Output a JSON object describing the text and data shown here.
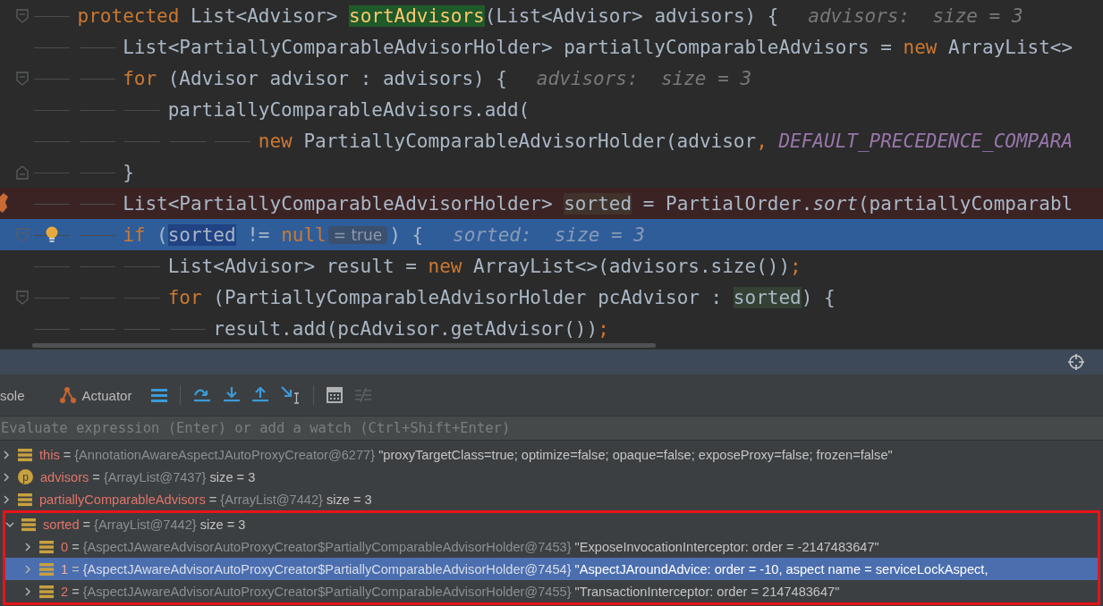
{
  "editor": {
    "lines": [
      {
        "fold_start": true,
        "fold_end": false,
        "breakpoint": false,
        "execution": false,
        "bulb": false,
        "continuation": false,
        "tokens": [
          {
            "kind": "keyword",
            "text": "protected"
          },
          {
            "kind": "text",
            "text": " List<Advisor> "
          },
          {
            "kind": "method",
            "text": "sortAdvisors"
          },
          {
            "kind": "text",
            "text": "(List<Advisor> advisors) {"
          },
          {
            "kind": "hint",
            "text": "advisors:  size = 3"
          }
        ],
        "children": [
          {
            "fold_start": false,
            "fold_end": false,
            "breakpoint": false,
            "execution": false,
            "bulb": false,
            "continuation": false,
            "tokens": [
              {
                "kind": "text",
                "text": "List<PartiallyComparableAdvisorHolder> partiallyComparableAdvisors = "
              },
              {
                "kind": "keyword",
                "text": "new"
              },
              {
                "kind": "text",
                "text": " ArrayList<>"
              }
            ]
          },
          {
            "fold_start": true,
            "fold_end": false,
            "breakpoint": false,
            "execution": false,
            "bulb": false,
            "continuation": false,
            "tokens": [
              {
                "kind": "keyword",
                "text": "for"
              },
              {
                "kind": "text",
                "text": " (Advisor advisor : advisors) {"
              },
              {
                "kind": "hint",
                "text": "advisors:  size = 3"
              }
            ],
            "children": [
              {
                "fold_start": false,
                "fold_end": false,
                "breakpoint": false,
                "execution": false,
                "bulb": false,
                "continuation": false,
                "tokens": [
                  {
                    "kind": "text",
                    "text": "partiallyComparableAdvisors.add("
                  }
                ],
                "children": [
                  {
                    "fold_start": false,
                    "fold_end": false,
                    "breakpoint": false,
                    "execution": false,
                    "bulb": false,
                    "continuation": true,
                    "tokens": [
                      {
                        "kind": "keyword",
                        "text": "new"
                      },
                      {
                        "kind": "text",
                        "text": " PartiallyComparableAdvisorHolder(advisor"
                      },
                      {
                        "kind": "keyword",
                        "text": ","
                      },
                      {
                        "kind": "constant",
                        "text": " DEFAULT_PRECEDENCE_COMPARA"
                      }
                    ]
                  }
                ]
              }
            ]
          },
          {
            "fold_start": false,
            "fold_end": true,
            "breakpoint": false,
            "execution": false,
            "bulb": false,
            "continuation": false,
            "tokens": [
              {
                "kind": "text",
                "text": "}"
              }
            ]
          },
          {
            "fold_start": false,
            "fold_end": false,
            "breakpoint": true,
            "execution": false,
            "bulb": false,
            "continuation": false,
            "tokens": [
              {
                "kind": "text",
                "text": "List<PartiallyComparableAdvisorHolder> "
              },
              {
                "kind": "write_usage",
                "text": "sorted"
              },
              {
                "kind": "text",
                "text": " = PartialOrder."
              },
              {
                "kind": "static",
                "text": "sort"
              },
              {
                "kind": "text",
                "text": "(partiallyComparabl"
              }
            ]
          },
          {
            "fold_start": true,
            "fold_end": false,
            "breakpoint": false,
            "execution": true,
            "bulb": true,
            "continuation": false,
            "tokens": [
              {
                "kind": "keyword",
                "text": "if"
              },
              {
                "kind": "text",
                "text": " ("
              },
              {
                "kind": "selected",
                "text": "sorted"
              },
              {
                "kind": "text",
                "text": " != "
              },
              {
                "kind": "keyword",
                "text": "null"
              },
              {
                "kind": "value",
                "text": "= true"
              },
              {
                "kind": "text",
                "text": ") {"
              },
              {
                "kind": "hint",
                "text": "sorted:  size = 3"
              }
            ],
            "children": [
              {
                "fold_start": false,
                "fold_end": false,
                "breakpoint": false,
                "execution": false,
                "bulb": false,
                "continuation": false,
                "tokens": [
                  {
                    "kind": "text",
                    "text": "List<Advisor> result = "
                  },
                  {
                    "kind": "keyword",
                    "text": "new"
                  },
                  {
                    "kind": "text",
                    "text": " ArrayList<>(advisors.size())"
                  },
                  {
                    "kind": "keyword",
                    "text": ";"
                  }
                ]
              },
              {
                "fold_start": true,
                "fold_end": false,
                "breakpoint": false,
                "execution": false,
                "bulb": false,
                "continuation": false,
                "tokens": [
                  {
                    "kind": "keyword",
                    "text": "for"
                  },
                  {
                    "kind": "text",
                    "text": " (PartiallyComparableAdvisorHolder pcAdvisor : "
                  },
                  {
                    "kind": "read_usage",
                    "text": "sorted"
                  },
                  {
                    "kind": "text",
                    "text": ") {"
                  }
                ],
                "children": [
                  {
                    "fold_start": false,
                    "fold_end": false,
                    "breakpoint": false,
                    "execution": false,
                    "bulb": false,
                    "continuation": false,
                    "tokens": [
                      {
                        "kind": "text",
                        "text": "result.add(pcAdvisor.getAdvisor())"
                      },
                      {
                        "kind": "keyword",
                        "text": ";"
                      }
                    ]
                  }
                ]
              }
            ]
          }
        ]
      }
    ]
  },
  "toolbar": {
    "tabs": [
      {
        "label": "sole"
      },
      {
        "label": "Actuator"
      }
    ]
  },
  "evaluate": {
    "placeholder": "Evaluate expression (Enter) or add a watch (Ctrl+Shift+Enter)"
  },
  "variables": [
    {
      "kind": "field",
      "name": "this",
      "eq": "=",
      "type": "{AnnotationAwareAspectJAutoProxyCreator@6277}",
      "value": "\"proxyTargetClass=true; optimize=false; opaque=false; exposeProxy=false; frozen=false\"",
      "expanded": false,
      "selected": false,
      "framed": false
    },
    {
      "kind": "parameter",
      "icon_letter": "p",
      "name": "advisors",
      "eq": "=",
      "type": "{ArrayList@7437}",
      "value": "size = 3",
      "expanded": false,
      "selected": false,
      "framed": false
    },
    {
      "kind": "field",
      "name": "partiallyComparableAdvisors",
      "eq": "=",
      "type": "{ArrayList@7442}",
      "value": "size = 3",
      "expanded": false,
      "selected": false,
      "framed": false
    },
    {
      "kind": "field",
      "name": "sorted",
      "eq": "=",
      "type": "{ArrayList@7442}",
      "value": "size = 3",
      "expanded": true,
      "selected": false,
      "framed": true,
      "children": [
        {
          "kind": "field",
          "name": "0",
          "eq": "=",
          "type": "{AspectJAwareAdvisorAutoProxyCreator$PartiallyComparableAdvisorHolder@7453}",
          "value": "\"ExposeInvocationInterceptor: order = -2147483647\"",
          "expanded": false,
          "selected": false
        },
        {
          "kind": "field",
          "name": "1",
          "eq": "=",
          "type": "{AspectJAwareAdvisorAutoProxyCreator$PartiallyComparableAdvisorHolder@7454}",
          "value": "\"AspectJAroundAdvice: order = -10, aspect name = serviceLockAspect,",
          "expanded": false,
          "selected": true
        },
        {
          "kind": "field",
          "name": "2",
          "eq": "=",
          "type": "{AspectJAwareAdvisorAutoProxyCreator$PartiallyComparableAdvisorHolder@7455}",
          "value": "\"TransactionInterceptor: order = 2147483647\"",
          "expanded": false,
          "selected": false
        }
      ]
    }
  ]
}
